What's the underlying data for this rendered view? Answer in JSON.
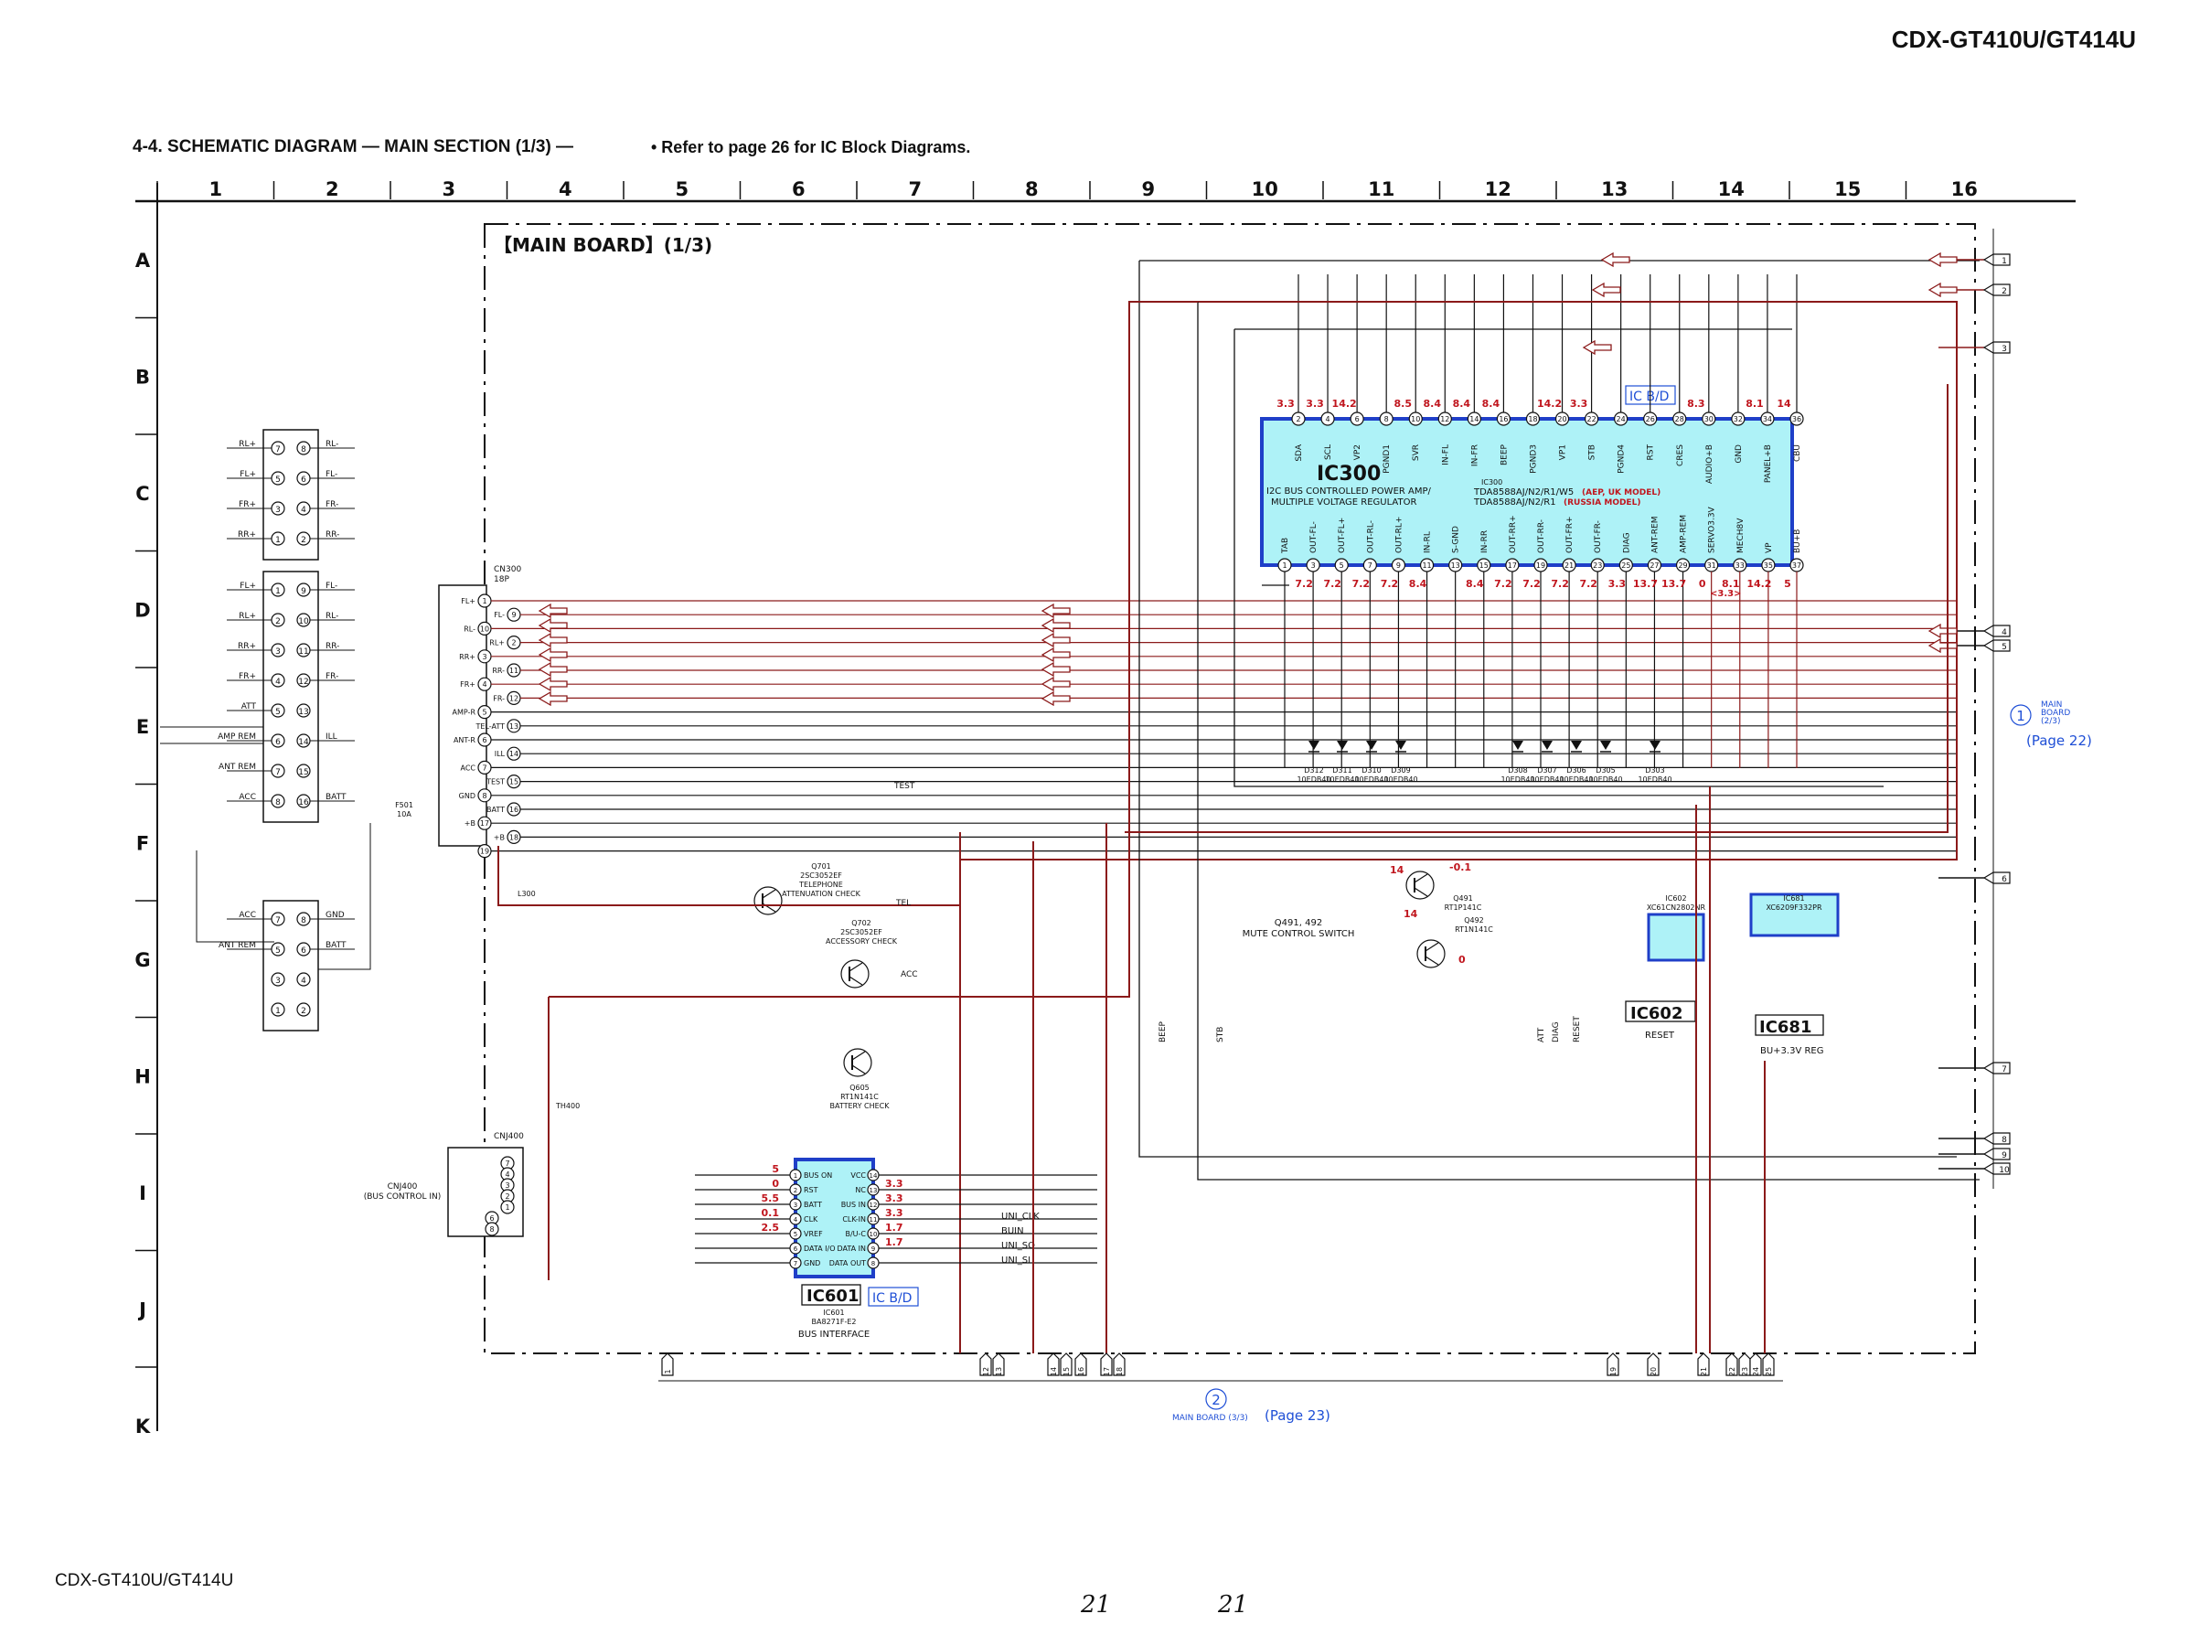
{
  "header": {
    "model": "CDX-GT410U/GT414U",
    "section_title": "4-4.  SCHEMATIC DIAGRAM — MAIN SECTION (1/3) —",
    "reference_note": "•  Refer to page 26 for IC Block Diagrams."
  },
  "footer": {
    "model": "CDX-GT410U/GT414U",
    "page_left": "21",
    "page_right": "21"
  },
  "grid": {
    "columns": [
      "1",
      "2",
      "3",
      "4",
      "5",
      "6",
      "7",
      "8",
      "9",
      "10",
      "11",
      "12",
      "13",
      "14",
      "15",
      "16"
    ],
    "rows": [
      "A",
      "B",
      "C",
      "D",
      "E",
      "F",
      "G",
      "H",
      "I",
      "J",
      "K"
    ]
  },
  "board": {
    "title": "【MAIN BOARD】(1/3)"
  },
  "ic300": {
    "ref": "IC300",
    "desc_line1": "I2C BUS CONTROLLED POWER AMP/",
    "desc_line2": "MULTIPLE VOLTAGE REGULATOR",
    "part_label": "IC300",
    "part_line1": "TDA8588AJ/N2/R1/W5",
    "part_note1": "(AEP, UK MODEL)",
    "part_line2": "TDA8588AJ/N2/R1",
    "part_note2": "(RUSSIA MODEL)",
    "block_tag": "IC B/D",
    "top_pins": [
      {
        "num": "2",
        "name": "SDA",
        "v": "3.3"
      },
      {
        "num": "4",
        "name": "SCL",
        "v": "3.3"
      },
      {
        "num": "6",
        "name": "VP2",
        "v": "14.2"
      },
      {
        "num": "8",
        "name": "PGND1",
        "v": ""
      },
      {
        "num": "10",
        "name": "SVR",
        "v": "8.5"
      },
      {
        "num": "12",
        "name": "IN-FL",
        "v": "8.4"
      },
      {
        "num": "14",
        "name": "IN-FR",
        "v": "8.4"
      },
      {
        "num": "16",
        "name": "BEEP",
        "v": "8.4"
      },
      {
        "num": "18",
        "name": "PGND3",
        "v": ""
      },
      {
        "num": "20",
        "name": "VP1",
        "v": "14.2"
      },
      {
        "num": "22",
        "name": "STB",
        "v": "3.3"
      },
      {
        "num": "24",
        "name": "PGND4",
        "v": ""
      },
      {
        "num": "26",
        "name": "RST",
        "v": ""
      },
      {
        "num": "28",
        "name": "CRES",
        "v": ""
      },
      {
        "num": "30",
        "name": "AUDIO+B",
        "v": "8.3"
      },
      {
        "num": "32",
        "name": "GND",
        "v": ""
      },
      {
        "num": "34",
        "name": "PANEL+B",
        "v": "8.1"
      },
      {
        "num": "36",
        "name": "CBU",
        "v": "14"
      }
    ],
    "bottom_pins": [
      {
        "num": "1",
        "name": "TAB",
        "v": ""
      },
      {
        "num": "3",
        "name": "OUT-FL-",
        "v": "7.2"
      },
      {
        "num": "5",
        "name": "OUT-FL+",
        "v": "7.2"
      },
      {
        "num": "7",
        "name": "OUT-RL-",
        "v": "7.2"
      },
      {
        "num": "9",
        "name": "OUT-RL+",
        "v": "7.2"
      },
      {
        "num": "11",
        "name": "IN-RL",
        "v": "8.4"
      },
      {
        "num": "13",
        "name": "S-GND",
        "v": ""
      },
      {
        "num": "15",
        "name": "IN-RR",
        "v": "8.4"
      },
      {
        "num": "17",
        "name": "OUT-RR+",
        "v": "7.2"
      },
      {
        "num": "19",
        "name": "OUT-RR-",
        "v": "7.2"
      },
      {
        "num": "21",
        "name": "OUT-FR+",
        "v": "7.2"
      },
      {
        "num": "23",
        "name": "OUT-FR-",
        "v": "7.2"
      },
      {
        "num": "25",
        "name": "DIAG",
        "v": "3.3"
      },
      {
        "num": "27",
        "name": "ANT-REM",
        "v": "13.7"
      },
      {
        "num": "29",
        "name": "AMP-REM",
        "v": "13.7"
      },
      {
        "num": "31",
        "name": "SERVO3.3V",
        "v": "0"
      },
      {
        "num": "33",
        "name": "MECH8V",
        "v": "8.1"
      },
      {
        "num": "35",
        "name": "VP",
        "v": "14.2"
      },
      {
        "num": "37",
        "name": "BU+B",
        "v": "5"
      }
    ],
    "servo_note": "<3.3>"
  },
  "cn300": {
    "ref": "CN300",
    "pins_label": "18P",
    "pins": [
      {
        "n": "1",
        "s": "FL+"
      },
      {
        "n": "9",
        "s": "FL-"
      },
      {
        "n": "10",
        "s": "RL-"
      },
      {
        "n": "2",
        "s": "RL+"
      },
      {
        "n": "3",
        "s": "RR+"
      },
      {
        "n": "11",
        "s": "RR-"
      },
      {
        "n": "4",
        "s": "FR+"
      },
      {
        "n": "12",
        "s": "FR-"
      },
      {
        "n": "5",
        "s": "AMP-R"
      },
      {
        "n": "13",
        "s": "TEL-ATT"
      },
      {
        "n": "6",
        "s": "ANT-R"
      },
      {
        "n": "14",
        "s": "ILL"
      },
      {
        "n": "7",
        "s": "ACC"
      },
      {
        "n": "15",
        "s": "TEST"
      },
      {
        "n": "8",
        "s": "GND"
      },
      {
        "n": "16",
        "s": "BATT"
      },
      {
        "n": "17",
        "s": "+B"
      },
      {
        "n": "18",
        "s": "+B"
      },
      {
        "n": "19",
        "s": ""
      }
    ]
  },
  "harness": {
    "top_block": [
      {
        "l": "RL+",
        "a": "7",
        "b": "8",
        "r": "RL-"
      },
      {
        "l": "FL+",
        "a": "5",
        "b": "6",
        "r": "FL-"
      },
      {
        "l": "FR+",
        "a": "3",
        "b": "4",
        "r": "FR-"
      },
      {
        "l": "RR+",
        "a": "1",
        "b": "2",
        "r": "RR-"
      }
    ],
    "mid_block": [
      {
        "l": "FL+",
        "a": "1",
        "b": "9",
        "r": "FL-"
      },
      {
        "l": "RL+",
        "a": "2",
        "b": "10",
        "r": "RL-"
      },
      {
        "l": "RR+",
        "a": "3",
        "b": "11",
        "r": "RR-"
      },
      {
        "l": "FR+",
        "a": "4",
        "b": "12",
        "r": "FR-"
      },
      {
        "l": "ATT",
        "a": "5",
        "b": "13",
        "r": ""
      },
      {
        "l": "AMP REM",
        "a": "6",
        "b": "14",
        "r": "ILL"
      },
      {
        "l": "ANT REM",
        "a": "7",
        "b": "15",
        "r": ""
      },
      {
        "l": "ACC",
        "a": "8",
        "b": "16",
        "r": "BATT"
      },
      {
        "l": "GND",
        "a": "",
        "b": "",
        "r": ""
      }
    ],
    "bottom_block": [
      {
        "l": "ACC",
        "a": "7",
        "b": "8",
        "r": "GND"
      },
      {
        "l": "ANT REM",
        "a": "5",
        "b": "6",
        "r": "BATT"
      },
      {
        "l": "",
        "a": "3",
        "b": "4",
        "r": ""
      },
      {
        "l": "",
        "a": "1",
        "b": "2",
        "r": ""
      }
    ]
  },
  "labels": {
    "f501": "F501\n10A",
    "l300": "L300",
    "th400": "TH400",
    "cnj400_ref": "CNJ400",
    "cnj400_desc": "CNJ400\n(BUS CONTROL IN)",
    "q491_492": "Q491, 492\nMUTE CONTROL SWITCH",
    "q701": "Q701\n2SC3052EF\nTELEPHONE\nATTENUATION CHECK",
    "q702": "Q702\n2SC3052EF\nACCESSORY CHECK",
    "q605": "Q605\nRT1N141C\nBATTERY CHECK",
    "q491": "Q491\nRT1P141C",
    "q492": "Q492\nRT1N141C",
    "ic602_ref": "IC602",
    "ic602_part": "IC602\nXC61CN2802NR",
    "ic602_func": "RESET",
    "ic681_ref": "IC681",
    "ic681_part": "IC681\nXC6209F332PR",
    "ic681_func": "BU+3.3V REG",
    "ic601_ref": "IC601",
    "ic601_tag": "IC B/D",
    "ic601_part": "IC601\nBA8271F-E2",
    "ic601_func": "BUS INTERFACE",
    "ic601_left": [
      "BUS ON",
      "RST",
      "BATT",
      "CLK",
      "VREF",
      "DATA I/O",
      "GND"
    ],
    "ic601_right": [
      "VCC",
      "NC",
      "BUS IN",
      "CLK-IN",
      "B/U-C",
      "DATA IN",
      "DATA OUT"
    ],
    "ic601_lv": [
      "5",
      "0",
      "5.5",
      "0.1",
      "2.5",
      "",
      ""
    ],
    "ic601_rv": [
      "",
      "3.3",
      "3.3",
      "3.3",
      "1.7",
      "1.7",
      ""
    ],
    "bus_signals": [
      "UNI_CLK",
      "BUIN",
      "UNI_SO",
      "UNI_SI"
    ],
    "nets_bottom": [
      "BEEP",
      "STB",
      "ATT",
      "RESET",
      "DIAG"
    ],
    "tel": "TEL",
    "acc": "ACC",
    "test": "TEST",
    "q491_v": [
      "14",
      "-0.1",
      "14",
      "0"
    ]
  },
  "diodes_row": [
    "D312\n10EDB40",
    "D311\n10EDB40",
    "D310\n10EDB40",
    "D309\n10EDB40",
    "D308\n10EDB40",
    "D307\n10EDB40",
    "D306\n10EDB40",
    "D305\n10EDB40",
    "D303\n10EDB40"
  ],
  "right_ports": [
    "1",
    "2",
    "3",
    "4",
    "5",
    "6",
    "7",
    "8",
    "9",
    "10"
  ],
  "bottom_ports": [
    "1",
    "12",
    "13",
    "14",
    "15",
    "16",
    "17",
    "18",
    "19",
    "20",
    "21",
    "22",
    "23",
    "24",
    "25"
  ],
  "link_main_2": {
    "circle": "1",
    "text": "MAIN\nBOARD\n(2/3)",
    "page": "(Page 22)"
  },
  "link_main_3": {
    "circle": "2",
    "text": "MAIN BOARD (3/3)",
    "page": "(Page 23)"
  },
  "colors": {
    "wire": "#111111",
    "power": "#8b1a1a",
    "voltage": "#c0161e",
    "ic_fill": "#aef2f7",
    "ic_border": "#1f3fc8",
    "link": "#1f4fd6"
  }
}
